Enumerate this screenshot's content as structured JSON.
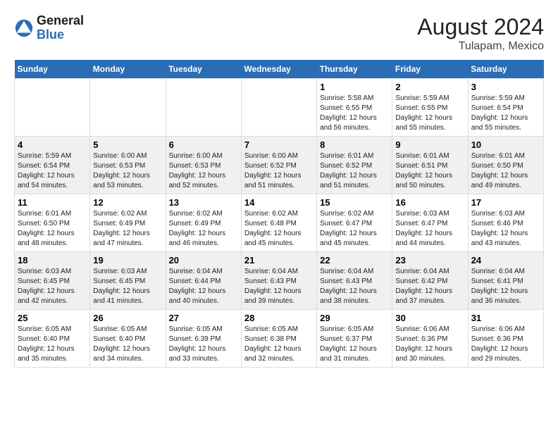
{
  "header": {
    "logo_line1": "General",
    "logo_line2": "Blue",
    "title": "August 2024",
    "subtitle": "Tulapam, Mexico"
  },
  "days_of_week": [
    "Sunday",
    "Monday",
    "Tuesday",
    "Wednesday",
    "Thursday",
    "Friday",
    "Saturday"
  ],
  "weeks": [
    [
      {
        "day": "",
        "sunrise": "",
        "sunset": "",
        "daylight": ""
      },
      {
        "day": "",
        "sunrise": "",
        "sunset": "",
        "daylight": ""
      },
      {
        "day": "",
        "sunrise": "",
        "sunset": "",
        "daylight": ""
      },
      {
        "day": "",
        "sunrise": "",
        "sunset": "",
        "daylight": ""
      },
      {
        "day": "1",
        "sunrise": "Sunrise: 5:58 AM",
        "sunset": "Sunset: 6:55 PM",
        "daylight": "Daylight: 12 hours and 56 minutes."
      },
      {
        "day": "2",
        "sunrise": "Sunrise: 5:59 AM",
        "sunset": "Sunset: 6:55 PM",
        "daylight": "Daylight: 12 hours and 55 minutes."
      },
      {
        "day": "3",
        "sunrise": "Sunrise: 5:59 AM",
        "sunset": "Sunset: 6:54 PM",
        "daylight": "Daylight: 12 hours and 55 minutes."
      }
    ],
    [
      {
        "day": "4",
        "sunrise": "Sunrise: 5:59 AM",
        "sunset": "Sunset: 6:54 PM",
        "daylight": "Daylight: 12 hours and 54 minutes."
      },
      {
        "day": "5",
        "sunrise": "Sunrise: 6:00 AM",
        "sunset": "Sunset: 6:53 PM",
        "daylight": "Daylight: 12 hours and 53 minutes."
      },
      {
        "day": "6",
        "sunrise": "Sunrise: 6:00 AM",
        "sunset": "Sunset: 6:53 PM",
        "daylight": "Daylight: 12 hours and 52 minutes."
      },
      {
        "day": "7",
        "sunrise": "Sunrise: 6:00 AM",
        "sunset": "Sunset: 6:52 PM",
        "daylight": "Daylight: 12 hours and 51 minutes."
      },
      {
        "day": "8",
        "sunrise": "Sunrise: 6:01 AM",
        "sunset": "Sunset: 6:52 PM",
        "daylight": "Daylight: 12 hours and 51 minutes."
      },
      {
        "day": "9",
        "sunrise": "Sunrise: 6:01 AM",
        "sunset": "Sunset: 6:51 PM",
        "daylight": "Daylight: 12 hours and 50 minutes."
      },
      {
        "day": "10",
        "sunrise": "Sunrise: 6:01 AM",
        "sunset": "Sunset: 6:50 PM",
        "daylight": "Daylight: 12 hours and 49 minutes."
      }
    ],
    [
      {
        "day": "11",
        "sunrise": "Sunrise: 6:01 AM",
        "sunset": "Sunset: 6:50 PM",
        "daylight": "Daylight: 12 hours and 48 minutes."
      },
      {
        "day": "12",
        "sunrise": "Sunrise: 6:02 AM",
        "sunset": "Sunset: 6:49 PM",
        "daylight": "Daylight: 12 hours and 47 minutes."
      },
      {
        "day": "13",
        "sunrise": "Sunrise: 6:02 AM",
        "sunset": "Sunset: 6:49 PM",
        "daylight": "Daylight: 12 hours and 46 minutes."
      },
      {
        "day": "14",
        "sunrise": "Sunrise: 6:02 AM",
        "sunset": "Sunset: 6:48 PM",
        "daylight": "Daylight: 12 hours and 45 minutes."
      },
      {
        "day": "15",
        "sunrise": "Sunrise: 6:02 AM",
        "sunset": "Sunset: 6:47 PM",
        "daylight": "Daylight: 12 hours and 45 minutes."
      },
      {
        "day": "16",
        "sunrise": "Sunrise: 6:03 AM",
        "sunset": "Sunset: 6:47 PM",
        "daylight": "Daylight: 12 hours and 44 minutes."
      },
      {
        "day": "17",
        "sunrise": "Sunrise: 6:03 AM",
        "sunset": "Sunset: 6:46 PM",
        "daylight": "Daylight: 12 hours and 43 minutes."
      }
    ],
    [
      {
        "day": "18",
        "sunrise": "Sunrise: 6:03 AM",
        "sunset": "Sunset: 6:45 PM",
        "daylight": "Daylight: 12 hours and 42 minutes."
      },
      {
        "day": "19",
        "sunrise": "Sunrise: 6:03 AM",
        "sunset": "Sunset: 6:45 PM",
        "daylight": "Daylight: 12 hours and 41 minutes."
      },
      {
        "day": "20",
        "sunrise": "Sunrise: 6:04 AM",
        "sunset": "Sunset: 6:44 PM",
        "daylight": "Daylight: 12 hours and 40 minutes."
      },
      {
        "day": "21",
        "sunrise": "Sunrise: 6:04 AM",
        "sunset": "Sunset: 6:43 PM",
        "daylight": "Daylight: 12 hours and 39 minutes."
      },
      {
        "day": "22",
        "sunrise": "Sunrise: 6:04 AM",
        "sunset": "Sunset: 6:43 PM",
        "daylight": "Daylight: 12 hours and 38 minutes."
      },
      {
        "day": "23",
        "sunrise": "Sunrise: 6:04 AM",
        "sunset": "Sunset: 6:42 PM",
        "daylight": "Daylight: 12 hours and 37 minutes."
      },
      {
        "day": "24",
        "sunrise": "Sunrise: 6:04 AM",
        "sunset": "Sunset: 6:41 PM",
        "daylight": "Daylight: 12 hours and 36 minutes."
      }
    ],
    [
      {
        "day": "25",
        "sunrise": "Sunrise: 6:05 AM",
        "sunset": "Sunset: 6:40 PM",
        "daylight": "Daylight: 12 hours and 35 minutes."
      },
      {
        "day": "26",
        "sunrise": "Sunrise: 6:05 AM",
        "sunset": "Sunset: 6:40 PM",
        "daylight": "Daylight: 12 hours and 34 minutes."
      },
      {
        "day": "27",
        "sunrise": "Sunrise: 6:05 AM",
        "sunset": "Sunset: 6:39 PM",
        "daylight": "Daylight: 12 hours and 33 minutes."
      },
      {
        "day": "28",
        "sunrise": "Sunrise: 6:05 AM",
        "sunset": "Sunset: 6:38 PM",
        "daylight": "Daylight: 12 hours and 32 minutes."
      },
      {
        "day": "29",
        "sunrise": "Sunrise: 6:05 AM",
        "sunset": "Sunset: 6:37 PM",
        "daylight": "Daylight: 12 hours and 31 minutes."
      },
      {
        "day": "30",
        "sunrise": "Sunrise: 6:06 AM",
        "sunset": "Sunset: 6:36 PM",
        "daylight": "Daylight: 12 hours and 30 minutes."
      },
      {
        "day": "31",
        "sunrise": "Sunrise: 6:06 AM",
        "sunset": "Sunset: 6:36 PM",
        "daylight": "Daylight: 12 hours and 29 minutes."
      }
    ]
  ]
}
